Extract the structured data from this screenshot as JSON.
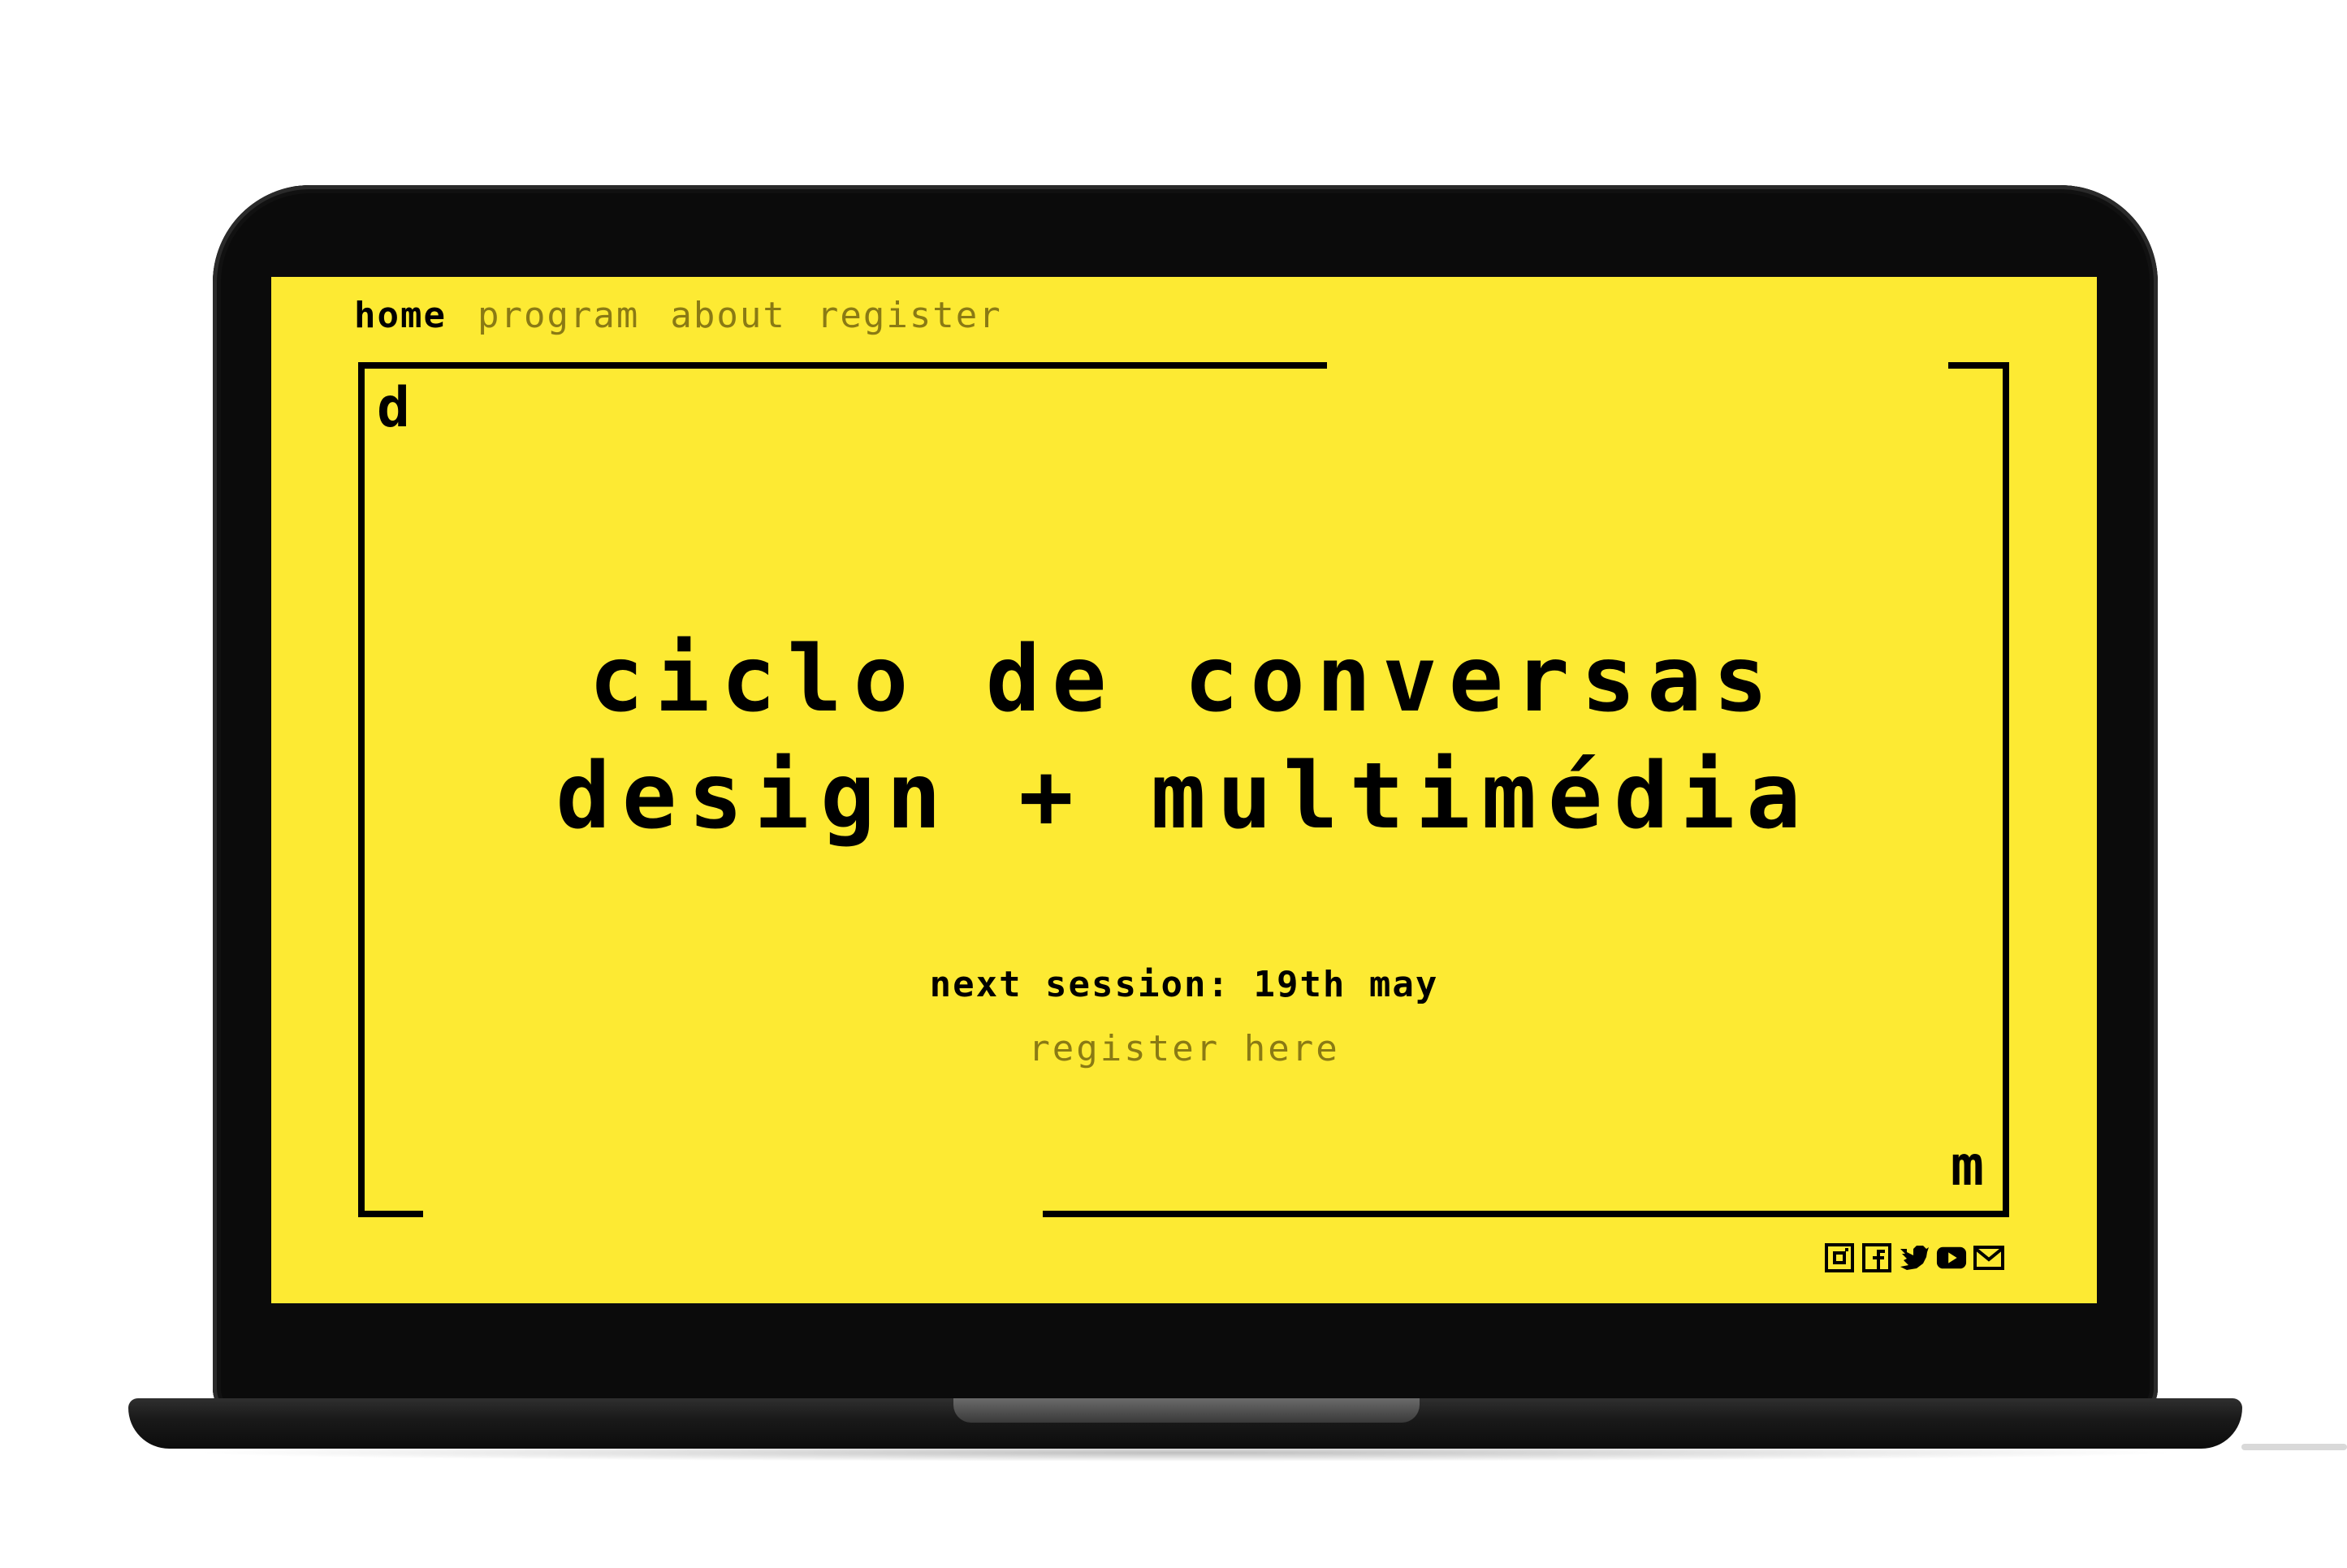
{
  "nav": {
    "items": [
      {
        "label": "home",
        "active": true
      },
      {
        "label": "program",
        "active": false
      },
      {
        "label": "about",
        "active": false
      },
      {
        "label": "register",
        "active": false
      }
    ]
  },
  "hero": {
    "corner_top_left": "d",
    "corner_bottom_right": "m",
    "title_line_1": "ciclo de conversas",
    "title_line_2": "design + multimédia",
    "next_session": "next session: 19th may",
    "register_link": "register here"
  },
  "social": {
    "icons": [
      "instagram-icon",
      "facebook-icon",
      "twitter-icon",
      "youtube-icon",
      "mail-icon"
    ]
  },
  "colors": {
    "background": "#fdea33",
    "text": "#000000",
    "muted": "#8a7a14"
  }
}
